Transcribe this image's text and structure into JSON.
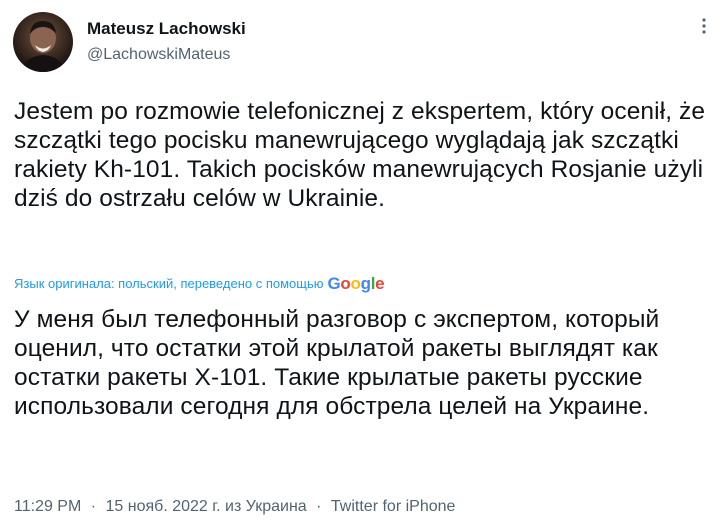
{
  "author": {
    "display_name": "Mateusz Lachowski",
    "handle": "@LachowskiMateus"
  },
  "tweet": {
    "original_text": "Jestem po rozmowie telefonicznej z ekspertem, który ocenił, że szczątki tego pocisku manewrującego wyglądają jak szczątki rakiety Kh-101. Takich pocisków manewrujących Rosjanie użyli dziś do ostrzału celów w Ukrainie.",
    "translation_note": "Язык оригинала: польский, переведено с помощью",
    "translation_provider": {
      "g1": "G",
      "o1": "o",
      "o2": "o",
      "g2": "g",
      "l": "l",
      "e": "e"
    },
    "translated_text": "У меня был телефонный разговор с экспертом, который оценил, что остатки этой крылатой ракеты выглядят как остатки ракеты Х-101. Такие крылатые ракеты русские использовали сегодня для обстрела целей на Украине."
  },
  "meta": {
    "time": "11:29 PM",
    "separator": "·",
    "date": "15 нояб. 2022 г. из Украина",
    "source": "Twitter for iPhone"
  },
  "colors": {
    "link": "#1d9bf0",
    "secondary_text": "#536471",
    "primary_text": "#0f1419"
  },
  "icons": {
    "more": "more-horizontal-icon"
  }
}
